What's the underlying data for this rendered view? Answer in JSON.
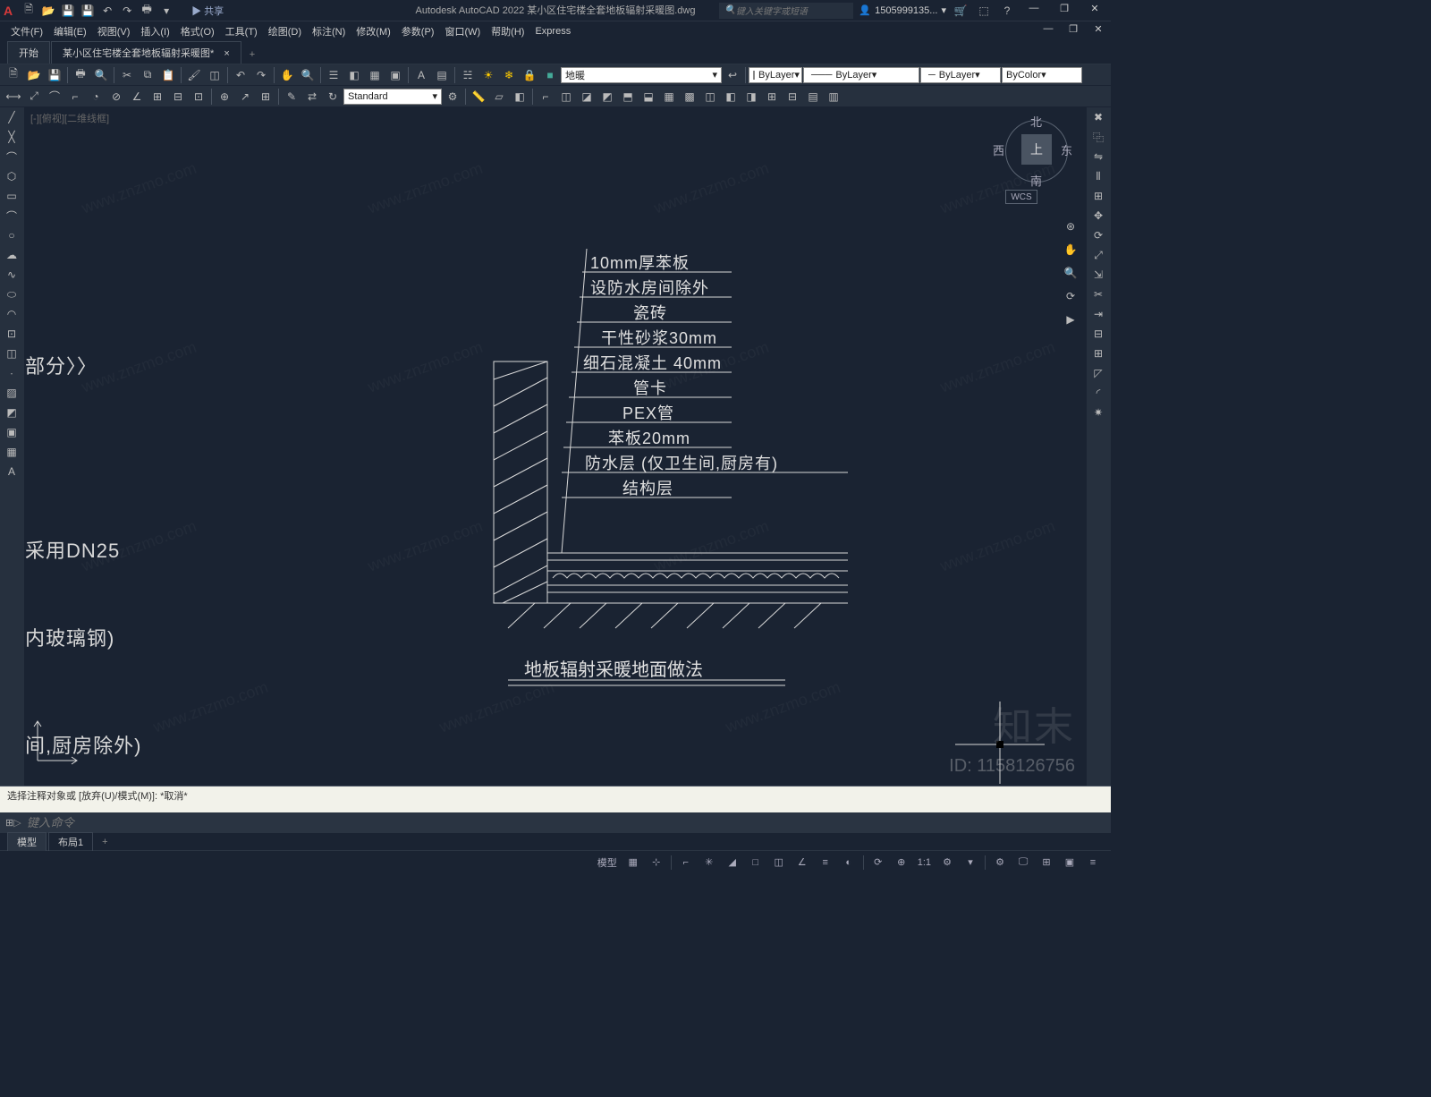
{
  "app": {
    "logo": "A",
    "title": "Autodesk AutoCAD 2022   某小区住宅楼全套地板辐射采暖图.dwg"
  },
  "qat_share": "▶ 共享",
  "search": {
    "placeholder": "键入关键字或短语"
  },
  "user": {
    "name": "1505999135..."
  },
  "window_controls": {
    "min": "—",
    "restore": "❐",
    "close": "✕"
  },
  "menus": [
    "文件(F)",
    "编辑(E)",
    "视图(V)",
    "插入(I)",
    "格式(O)",
    "工具(T)",
    "绘图(D)",
    "标注(N)",
    "修改(M)",
    "参数(P)",
    "窗口(W)",
    "帮助(H)",
    "Express"
  ],
  "tabs": {
    "start": "开始",
    "doc": "某小区住宅楼全套地板辐射采暖图*",
    "close": "×",
    "add": "+"
  },
  "toolbar2": {
    "text_style": "Standard",
    "layer_name": "地暖",
    "linetype": "ByLayer",
    "lineweight": "ByLayer",
    "lineweight2": "ByLayer",
    "color": "ByColor"
  },
  "viewport": {
    "label": "[-][俯视][二维线框]"
  },
  "viewcube": {
    "n": "北",
    "s": "南",
    "e": "东",
    "w": "西",
    "top": "上",
    "wcs": "WCS"
  },
  "drawing": {
    "left_texts": [
      "部分〉〉",
      "采用DN25",
      "内玻璃钢)",
      "间,厨房除外)"
    ],
    "labels": [
      "10mm厚苯板",
      "设防水房间除外",
      "瓷砖",
      "干性砂浆30mm",
      "细石混凝土  40mm",
      "管卡",
      "PEX管",
      "苯板20mm",
      "防水层 (仅卫生间,厨房有)",
      "结构层"
    ],
    "title": "地板辐射采暖地面做法"
  },
  "cmd": {
    "history": "选择注释对象或  [放弃(U)/模式(M)]:  *取消*",
    "prompt": "▷",
    "placeholder": "键入命令"
  },
  "layout_tabs": [
    "模型",
    "布局1"
  ],
  "status": {
    "scale": "1:1",
    "customize": "≡"
  },
  "wm": {
    "brand": "知末",
    "id": "ID: 1158126756",
    "repeat": "www.znzmo.com"
  }
}
